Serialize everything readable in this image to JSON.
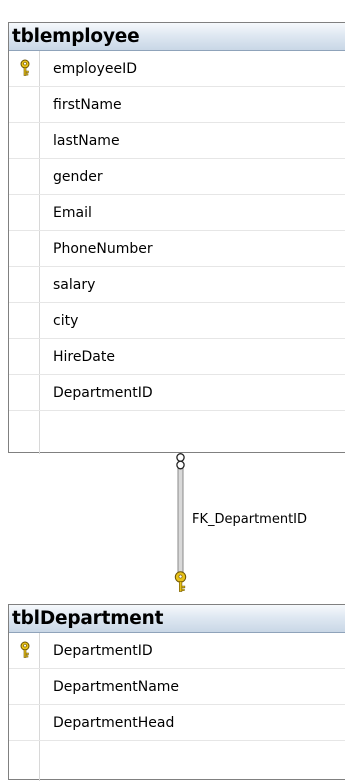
{
  "tables": [
    {
      "id": "tblemployee",
      "title": "tblemployee",
      "columns": [
        {
          "name": "employeeID",
          "primary_key": true
        },
        {
          "name": "firstName",
          "primary_key": false
        },
        {
          "name": "lastName",
          "primary_key": false
        },
        {
          "name": "gender",
          "primary_key": false
        },
        {
          "name": "Email",
          "primary_key": false
        },
        {
          "name": "PhoneNumber",
          "primary_key": false
        },
        {
          "name": "salary",
          "primary_key": false
        },
        {
          "name": "city",
          "primary_key": false
        },
        {
          "name": "HireDate",
          "primary_key": false
        },
        {
          "name": "DepartmentID",
          "primary_key": false
        }
      ]
    },
    {
      "id": "tblDepartment",
      "title": "tblDepartment",
      "columns": [
        {
          "name": "DepartmentID",
          "primary_key": true
        },
        {
          "name": "DepartmentName",
          "primary_key": false
        },
        {
          "name": "DepartmentHead",
          "primary_key": false
        }
      ]
    }
  ],
  "relationship": {
    "label": "FK_DepartmentID",
    "many_end_icon": "infinity-icon",
    "one_end_icon": "key-icon"
  },
  "colors": {
    "header_top": "#f6f9fc",
    "header_bottom": "#c9d7e6",
    "key_gold": "#e8c21a",
    "connector": "#9a9a9a"
  }
}
